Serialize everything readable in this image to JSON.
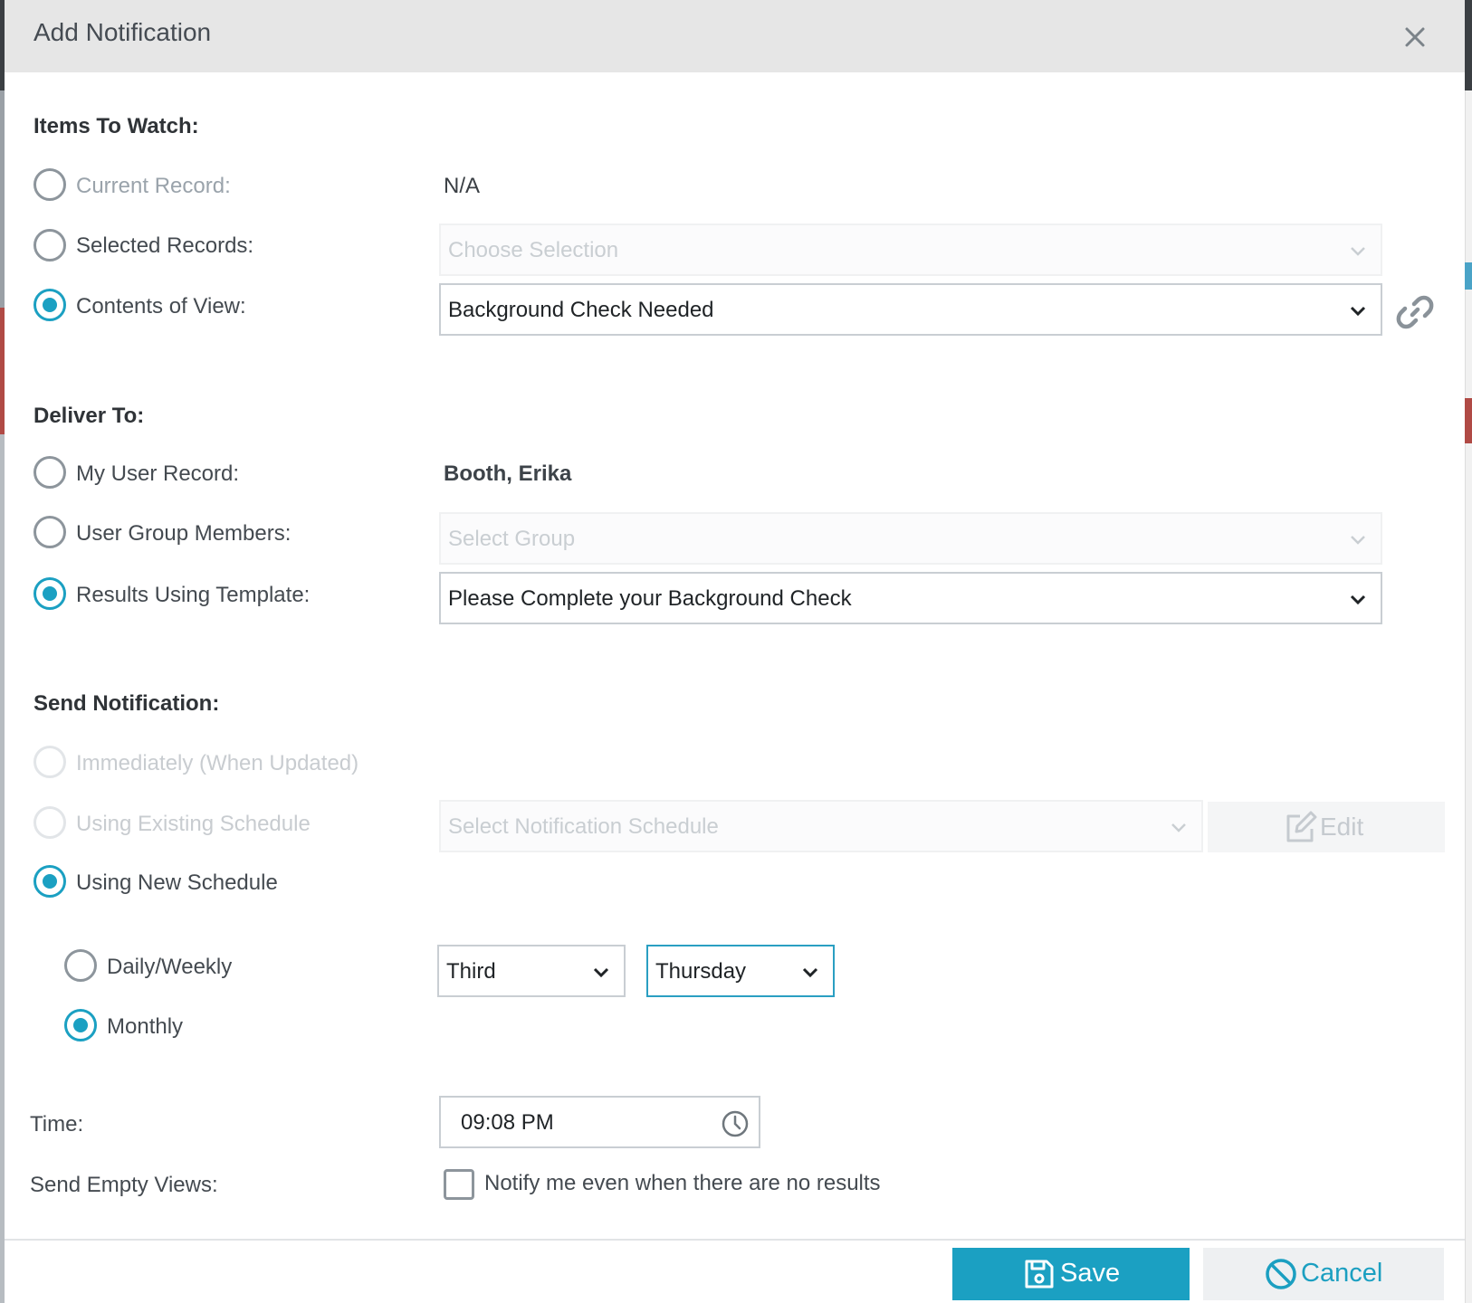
{
  "dialog": {
    "title": "Add Notification"
  },
  "items_to_watch": {
    "heading": "Items To Watch:",
    "current_record": {
      "label": "Current Record:",
      "value": "N/A"
    },
    "selected_records": {
      "label": "Selected Records:",
      "placeholder": "Choose Selection"
    },
    "contents_of_view": {
      "label": "Contents of View:",
      "value": "Background Check Needed"
    }
  },
  "deliver_to": {
    "heading": "Deliver To:",
    "my_user_record": {
      "label": "My User Record:",
      "value": "Booth, Erika"
    },
    "user_group_members": {
      "label": "User Group Members:",
      "placeholder": "Select Group"
    },
    "results_using_template": {
      "label": "Results Using Template:",
      "value": "Please Complete your Background Check"
    }
  },
  "send_notification": {
    "heading": "Send Notification:",
    "immediately": {
      "label": "Immediately (When Updated)"
    },
    "existing_schedule": {
      "label": "Using Existing Schedule",
      "placeholder": "Select Notification Schedule",
      "edit_label": "Edit"
    },
    "new_schedule": {
      "label": "Using New Schedule"
    },
    "daily_weekly": {
      "label": "Daily/Weekly"
    },
    "monthly": {
      "label": "Monthly",
      "ordinal": "Third",
      "weekday": "Thursday"
    }
  },
  "time": {
    "label": "Time:",
    "value": "09:08 PM"
  },
  "send_empty": {
    "label": "Send Empty Views:",
    "checkbox_label": "Notify me even when there are no results"
  },
  "footer": {
    "save_label": "Save",
    "cancel_label": "Cancel"
  },
  "colors": {
    "accent": "#1ba0c2",
    "header_bg": "#e6e6e6"
  }
}
